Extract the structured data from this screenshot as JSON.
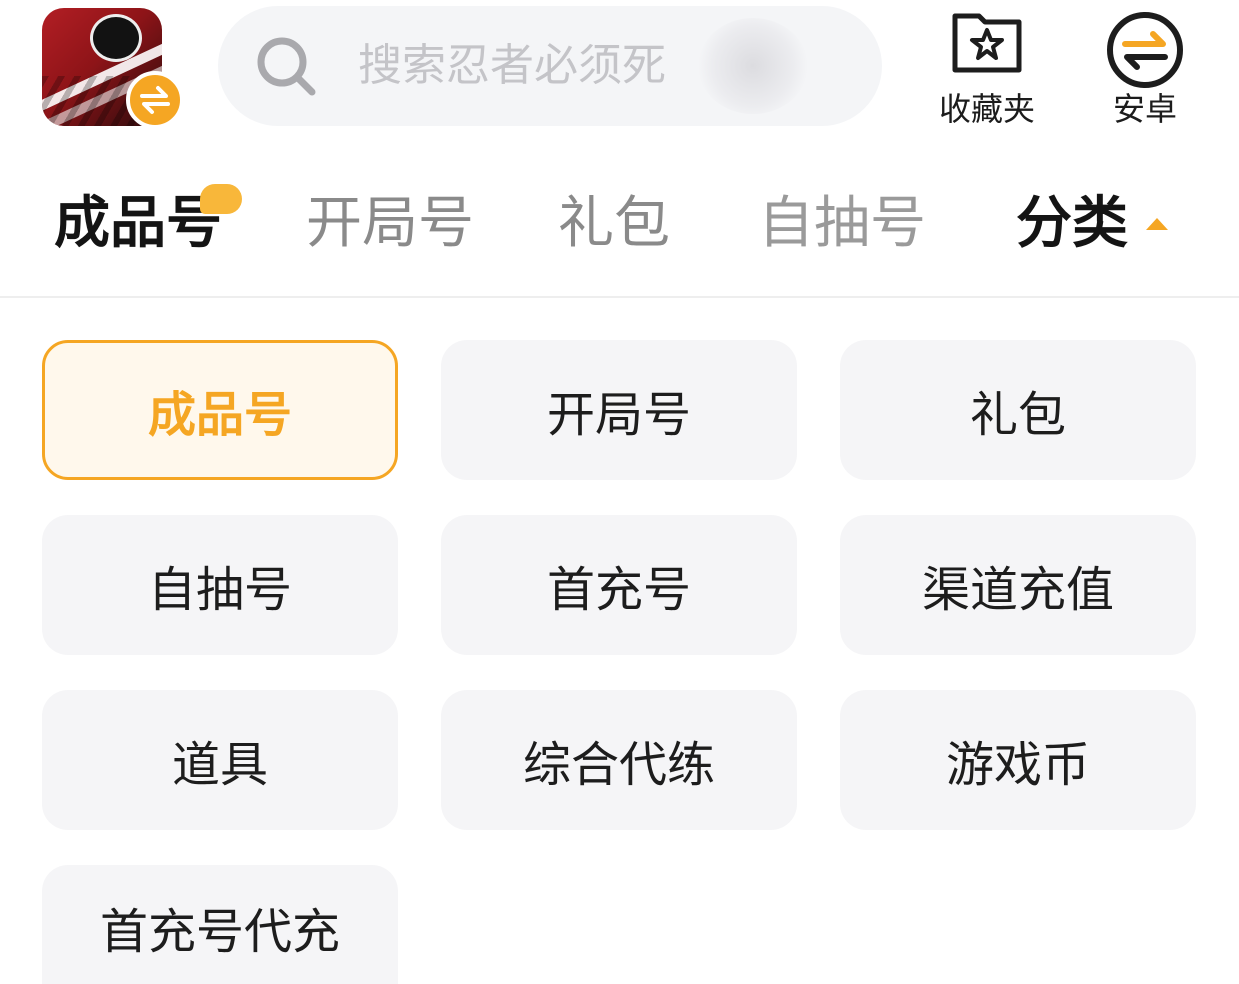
{
  "header": {
    "search_placeholder": "搜索忍者必须死",
    "favorites_label": "收藏夹",
    "platform_label": "安卓"
  },
  "tabs": [
    {
      "label": "成品号"
    },
    {
      "label": "开局号"
    },
    {
      "label": "礼包"
    },
    {
      "label": "自抽号"
    }
  ],
  "category_label": "分类",
  "grid": [
    {
      "label": "成品号"
    },
    {
      "label": "开局号"
    },
    {
      "label": "礼包"
    },
    {
      "label": "自抽号"
    },
    {
      "label": "首充号"
    },
    {
      "label": "渠道充值"
    },
    {
      "label": "道具"
    },
    {
      "label": "综合代练"
    },
    {
      "label": "游戏币"
    },
    {
      "label": "首充号代充"
    }
  ],
  "colors": {
    "accent": "#f5a623",
    "selected_bg": "#fff8ec",
    "cell_bg": "#f5f5f7",
    "search_bg": "#f4f5f7"
  },
  "icons": [
    "app-icon",
    "swap-icon",
    "search-icon",
    "star-folder-icon",
    "swap-circle-icon",
    "caret-up-icon"
  ]
}
